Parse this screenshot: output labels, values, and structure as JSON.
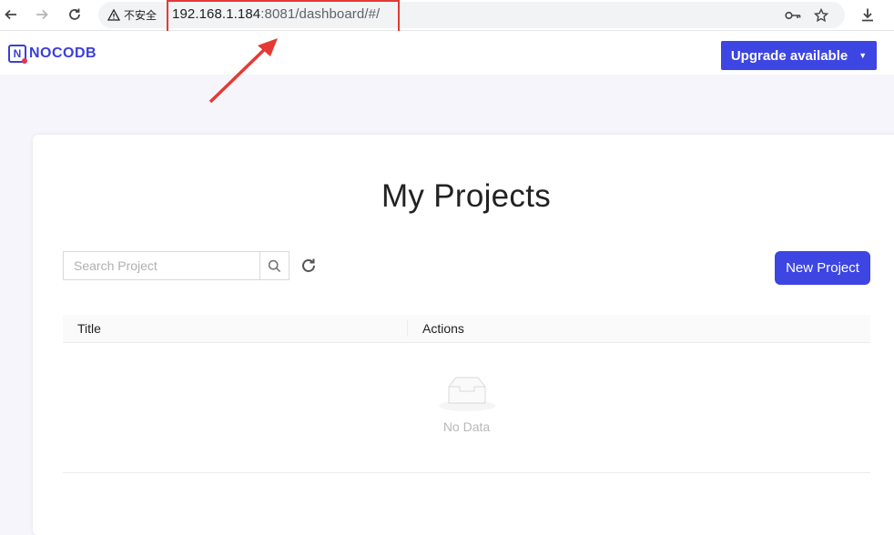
{
  "browser": {
    "security_label": "不安全",
    "url_host": "192.168.1.184",
    "url_rest": ":8081/dashboard/#/"
  },
  "header": {
    "logo_text": "NOCODB",
    "logo_letter": "N",
    "upgrade_label": "Upgrade available"
  },
  "main": {
    "title": "My Projects",
    "search_placeholder": "Search Project",
    "new_project_label": "New Project",
    "columns": [
      "Title",
      "Actions"
    ],
    "empty_text": "No Data"
  },
  "colors": {
    "brand": "#3d45e3",
    "annotation": "#e53935"
  },
  "icons": [
    "back-icon",
    "forward-icon",
    "reload-icon",
    "warning-icon",
    "key-icon",
    "star-icon",
    "download-icon",
    "search-icon",
    "refresh-icon",
    "empty-inbox-icon"
  ]
}
